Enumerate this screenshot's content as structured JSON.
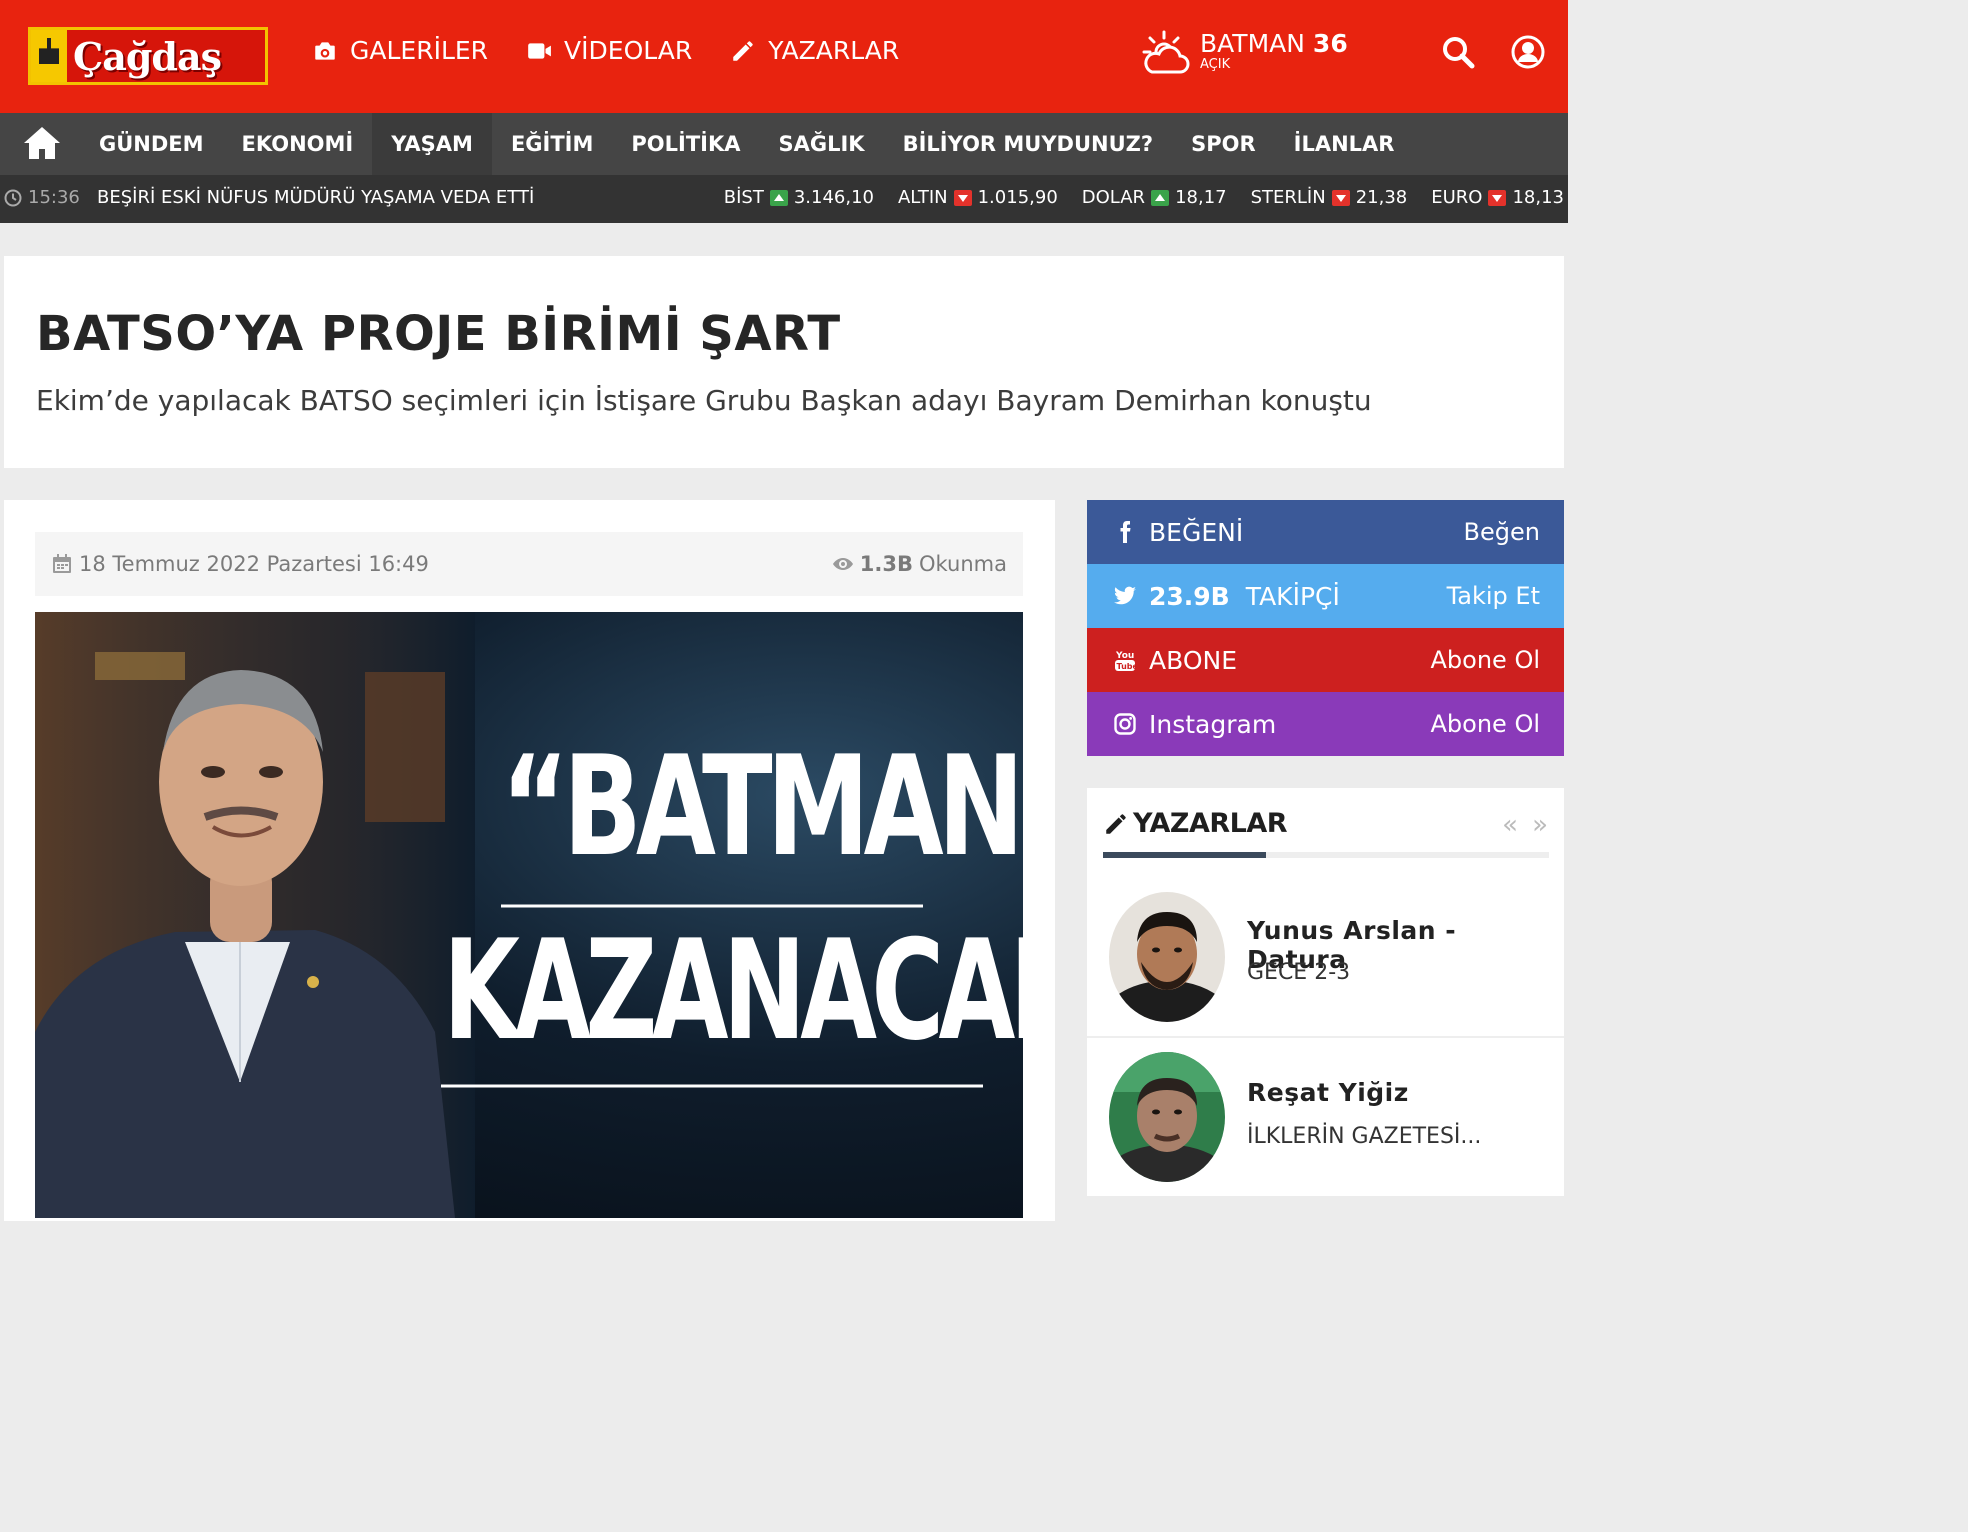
{
  "header": {
    "logo_text": "Çağdaş",
    "nav": [
      {
        "label": "GALERİLER",
        "icon": "camera-icon"
      },
      {
        "label": "VİDEOLAR",
        "icon": "video-icon"
      },
      {
        "label": "YAZARLAR",
        "icon": "pencil-icon"
      }
    ],
    "weather": {
      "city": "BATMAN",
      "temp": "36",
      "condition": "AÇIK",
      "icon": "sun-cloud-icon"
    },
    "search_icon": "search-icon",
    "user_icon": "user-icon",
    "color": "#e8230f"
  },
  "categories": {
    "home_icon": "home-icon",
    "items": [
      "GÜNDEM",
      "EKONOMİ",
      "YAŞAM",
      "EĞİTİM",
      "POLİTİKA",
      "SAĞLIK",
      "BİLİYOR MUYDUNUZ?",
      "SPOR",
      "İLANLAR"
    ]
  },
  "ticker": {
    "time": "15:36",
    "headline": "BEŞİRİ ESKİ NÜFUS MÜDÜRÜ YAŞAMA VEDA ETTİ",
    "markets": [
      {
        "name": "BİST",
        "direction": "up",
        "value": "3.146,10"
      },
      {
        "name": "ALTIN",
        "direction": "down",
        "value": "1.015,90"
      },
      {
        "name": "DOLAR",
        "direction": "up",
        "value": "18,17"
      },
      {
        "name": "STERLİN",
        "direction": "down",
        "value": "21,38"
      },
      {
        "name": "EURO",
        "direction": "down",
        "value": "18,13"
      }
    ]
  },
  "article": {
    "title": "BATSO’YA PROJE BİRİMİ ŞART",
    "subtitle": "Ekim’de yapılacak BATSO seçimleri için İstişare Grubu Başkan adayı Bayram Demirhan konuştu",
    "date": "18 Temmuz 2022 Pazartesi 16:49",
    "views_count": "1.3B",
    "views_label": "Okunma",
    "image_quote_line1": "“BATMAN",
    "image_quote_line2": "KAZANACAK”"
  },
  "social": [
    {
      "icon": "facebook-icon",
      "count": "",
      "label": "BEĞENİ",
      "action": "Beğen",
      "color": "#3b5998"
    },
    {
      "icon": "twitter-icon",
      "count": "23.9B",
      "label": "TAKİPÇİ",
      "action": "Takip Et",
      "color": "#55acee"
    },
    {
      "icon": "youtube-icon",
      "count": "",
      "label": "ABONE",
      "action": "Abone Ol",
      "color": "#cd201f"
    },
    {
      "icon": "instagram-icon",
      "count": "",
      "label": "Instagram",
      "action": "Abone Ol",
      "color": "#8a3ab9"
    }
  ],
  "writers": {
    "heading": "YAZARLAR",
    "prev": "«",
    "next": "»",
    "items": [
      {
        "name": "Yunus Arslan - Datura",
        "column": "GECE 2-3"
      },
      {
        "name": "Reşat Yiğiz",
        "column": "İLKLERİN GAZETESİ..."
      }
    ]
  }
}
